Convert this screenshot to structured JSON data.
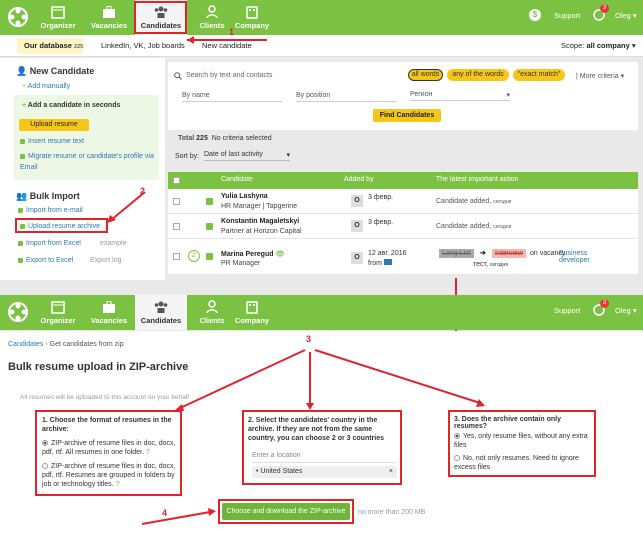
{
  "nav": {
    "items": [
      "Organizer",
      "Vacancies",
      "Candidates",
      "Clients",
      "Company"
    ],
    "support": "Support",
    "user": "Oleg",
    "badge_count": "3",
    "coin_symbol": "$"
  },
  "subnav": {
    "tabs": [
      {
        "label": "Our database",
        "count": "225"
      },
      {
        "label": "LinkedIn, VK, Job boards"
      },
      {
        "label": "New candidate"
      }
    ],
    "scope_label": "Scope:",
    "scope_value": "all company"
  },
  "sidebar": {
    "new_candidate": "New Candidate",
    "add_manually": "Add manually",
    "seconds_title": "Add a candidate in seconds",
    "upload_resume": "Upload resume",
    "insert_text": "Insert resume text",
    "migrate": "Migrate resume or candidate's profile via Email",
    "bulk_title": "Bulk Import",
    "import_email": "Import from e-mail",
    "upload_archive": "Upload resume archive",
    "import_excel": "Import from Excel",
    "example": "example",
    "export_excel": "Export to Excel",
    "export_log": "Export log"
  },
  "search": {
    "placeholder": "Search by text and contacts",
    "modes": [
      "all words",
      "any of the words",
      "\"exact match\""
    ],
    "more": "More criteria",
    "by_name": "By name",
    "by_position": "By position",
    "region": "Регион",
    "find_button": "Find Candidates"
  },
  "results": {
    "total_label": "Total",
    "total_value": "225",
    "no_criteria": "No criteria selected",
    "sort_label": "Sort by:",
    "sort_value": "Date of last activity",
    "headers": [
      "Candidate",
      "Added by",
      "The latest important action"
    ],
    "rows": [
      {
        "name": "Yulia Lashyna",
        "role": "HR Manager | Tapgerine",
        "avatar": "O",
        "date": "3 февр.",
        "action": "Candidate added,",
        "when": "сегодня"
      },
      {
        "name": "Konstantin Magaletskyi",
        "role": "Partner at Horizon Capital",
        "avatar": "O",
        "date": "3 февр.",
        "action": "Candidate added,",
        "when": "сегодня"
      },
      {
        "name": "Marina Peregud",
        "role": "PR Manager",
        "count": "2",
        "avatar": "O",
        "date": "12 авг. 2016",
        "from": "from",
        "tag1": "Long-List",
        "tag2": "Interview",
        "on_vacancy": "on vacancy",
        "vacancy": "Business developer",
        "extra": "тест,",
        "when": "сегодня"
      }
    ]
  },
  "breadcrumb": {
    "root": "Candidates",
    "current": "Get candidates from zip"
  },
  "page_title": "Bulk resume upload in ZIP-archive",
  "notice": "All resumes will be uploaded to this account on your behalf",
  "box1": {
    "title": "1. Choose the format of resumes in the archive:",
    "opt1": "ZIP-archive of resume files in doc, docx, pdf, rtf. All resumes in one folder.",
    "opt2": "ZIP-archive of resume files in doc, docx, pdf, rtf. Resumes are grouped in folders by job or technology titles."
  },
  "box2": {
    "title": "2. Select the candidates' country in the archive. If they are not from the same country, you can choose 2 or 3 countries",
    "placeholder": "Enter a location",
    "chip": "United States"
  },
  "box3": {
    "title": "3. Does the archive contain only resumes?",
    "opt1": "Yes, only resume files, without any extra files",
    "opt2": "No, not only resumes. Need to ignore excess files"
  },
  "submit": {
    "label": "Choose and download the ZIP-archive",
    "limit": "no more than 200 MB"
  },
  "annotations": [
    "1",
    "2",
    "3",
    "4"
  ],
  "colors": {
    "brand": "#7cc242",
    "accent": "#f5c518",
    "annotation": "#e0242b",
    "link": "#2a7ab8"
  }
}
